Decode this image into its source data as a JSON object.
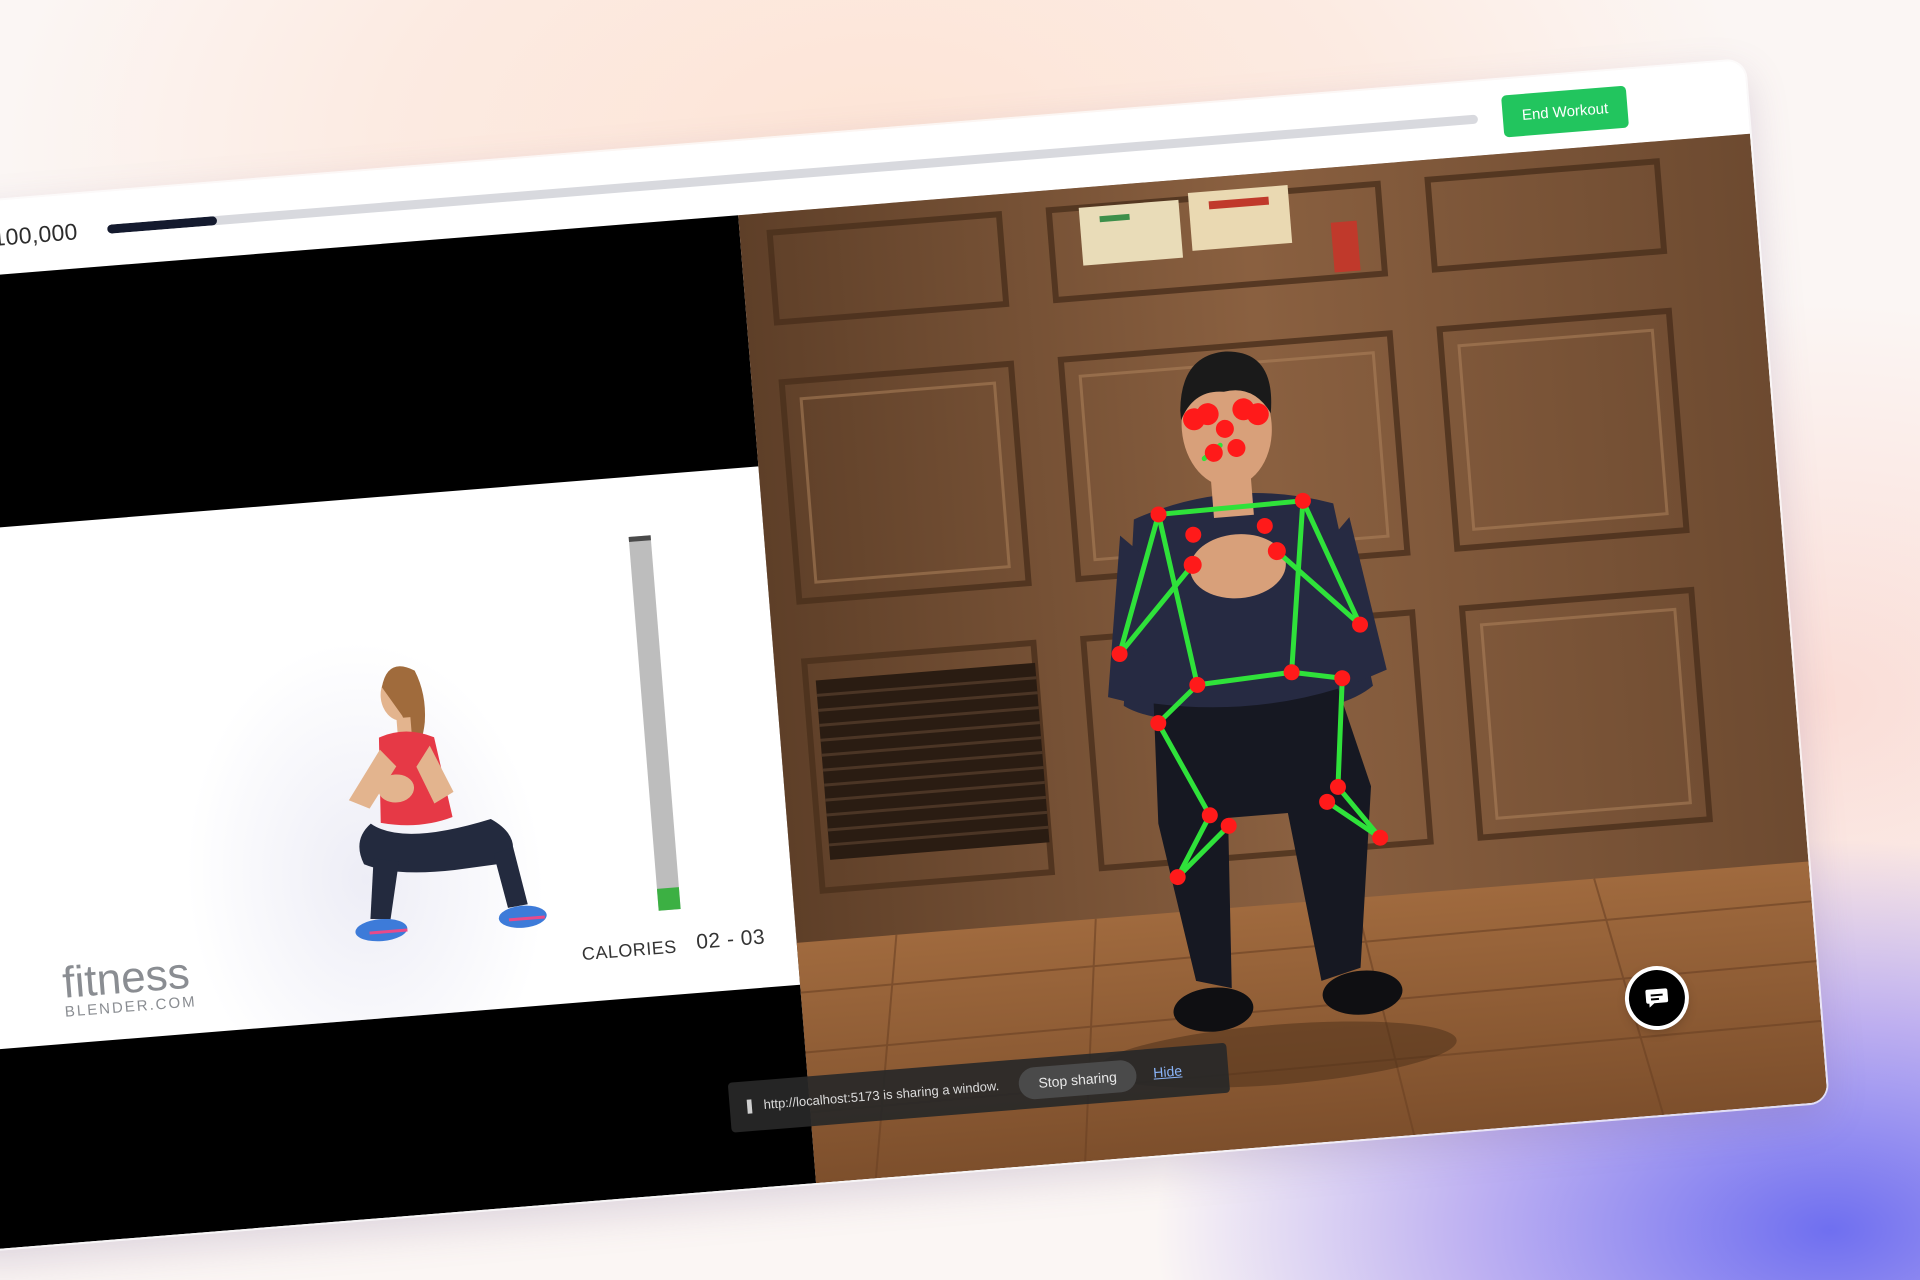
{
  "header": {
    "score": "100,000",
    "progress_fraction": 0.08,
    "end_button_label": "End Workout"
  },
  "reference_video": {
    "logo_main": "fitness",
    "logo_sub": "BLENDER.COM",
    "meter_fraction": 0.06,
    "calories_label": "CALORIES",
    "calories_value": "02 - 03"
  },
  "screen_share": {
    "message": "http://localhost:5173 is sharing a window.",
    "stop_label": "Stop sharing",
    "hide_label": "Hide"
  },
  "colors": {
    "accent_green": "#22c55e",
    "progress_fill": "#141a2e",
    "pose_line": "#2fe23a",
    "pose_joint": "#ff1a1a"
  },
  "icons": {
    "chat": "chat-bubble-icon",
    "share": "pause-bars-icon"
  }
}
